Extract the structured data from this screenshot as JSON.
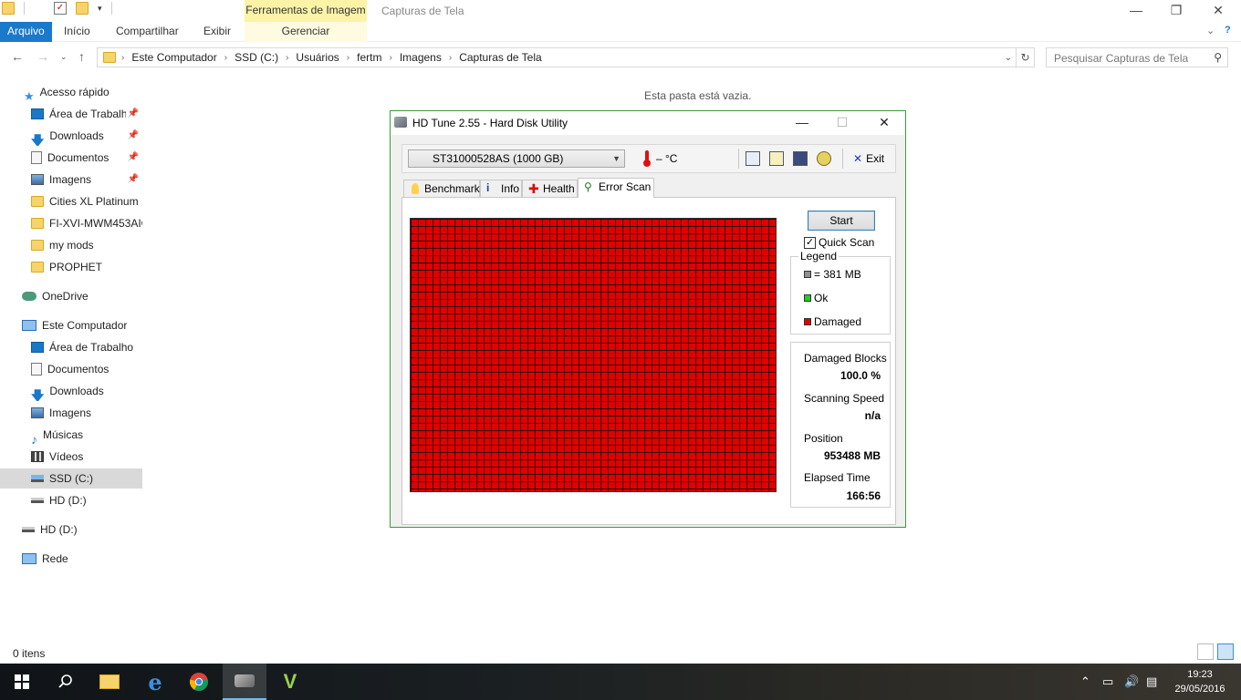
{
  "explorer": {
    "title": "Capturas de Tela",
    "tools_tab": "Ferramentas de Imagem",
    "tabs": [
      "Arquivo",
      "Início",
      "Compartilhar",
      "Exibir"
    ],
    "manage_tab": "Gerenciar",
    "breadcrumb": [
      "Este Computador",
      "SSD (C:)",
      "Usuários",
      "fertm",
      "Imagens",
      "Capturas de Tela"
    ],
    "search_placeholder": "Pesquisar Capturas de Tela",
    "empty_message": "Esta pasta está vazia.",
    "status": "0 itens",
    "nav": {
      "quick_access": "Acesso rápido",
      "quick_items": [
        "Área de Trabalho",
        "Downloads",
        "Documentos",
        "Imagens",
        "Cities XL Platinum",
        "FI-XVI-MWM453AIO",
        "my mods",
        "PROPHET"
      ],
      "onedrive": "OneDrive",
      "this_pc": "Este Computador",
      "pc_items": [
        "Área de Trabalho",
        "Documentos",
        "Downloads",
        "Imagens",
        "Músicas",
        "Vídeos",
        "SSD (C:)",
        "HD (D:)"
      ],
      "hd_d": "HD (D:)",
      "network": "Rede"
    }
  },
  "hdtune": {
    "title": "HD Tune 2.55 - Hard Disk Utility",
    "drive": "ST31000528AS (1000 GB)",
    "temperature": "– °C",
    "exit_label": "Exit",
    "tabs": [
      "Benchmark",
      "Info",
      "Health",
      "Error Scan"
    ],
    "start_label": "Start",
    "quick_scan_label": "Quick Scan",
    "quick_scan_checked": true,
    "legend_title": "Legend",
    "legend": [
      {
        "label": "= 381 MB",
        "color": "#909090"
      },
      {
        "label": "Ok",
        "color": "#22cc22"
      },
      {
        "label": "Damaged",
        "color": "#e00000"
      }
    ],
    "stats": {
      "damaged_label": "Damaged Blocks",
      "damaged_value": "100.0 %",
      "speed_label": "Scanning Speed",
      "speed_value": "n/a",
      "position_label": "Position",
      "position_value": "953488 MB",
      "elapsed_label": "Elapsed Time",
      "elapsed_value": "166:56"
    }
  },
  "taskbar": {
    "time": "19:23",
    "date": "29/05/2016"
  }
}
